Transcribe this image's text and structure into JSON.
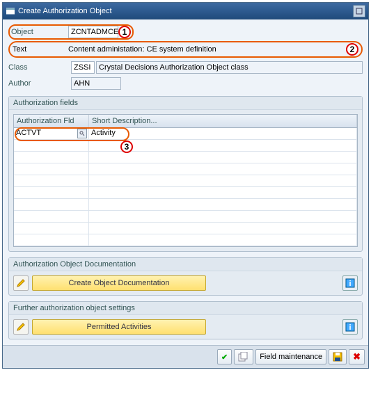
{
  "window": {
    "title": "Create Authorization Object"
  },
  "form": {
    "object_label": "Object",
    "object_value": "ZCNTADMCES",
    "text_label": "Text",
    "text_value": "Content administation: CE system definition",
    "class_label": "Class",
    "class_code": "ZSSI",
    "class_desc": "Crystal Decisions Authorization Object class",
    "author_label": "Author",
    "author_value": "AHN"
  },
  "fields_group": {
    "title": "Authorization fields",
    "col1": "Authorization Fld",
    "col2": "Short Description...",
    "rows": [
      {
        "fld": "ACTVT",
        "desc": "Activity"
      }
    ]
  },
  "doc_group": {
    "title": "Authorization Object Documentation",
    "button": "Create Object Documentation"
  },
  "settings_group": {
    "title": "Further authorization object settings",
    "button": "Permitted Activities"
  },
  "footer": {
    "field_maint": "Field maintenance"
  },
  "callouts": {
    "one": "1",
    "two": "2",
    "three": "3"
  }
}
